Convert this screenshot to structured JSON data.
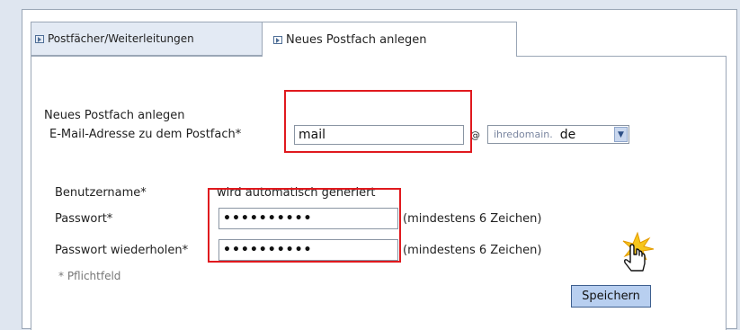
{
  "tabs": [
    {
      "label": "Postfächer/Weiterleitungen"
    },
    {
      "label": "Neues Postfach anlegen"
    }
  ],
  "form": {
    "heading": "Neues Postfach anlegen",
    "email_label": "E-Mail-Adresse zu dem Postfach*",
    "email_value": "mail",
    "at_sign": "@",
    "domain_placeholder": "ihredomain.",
    "domain_tld": "de",
    "username_label": "Benutzername*",
    "username_value": "wird automatisch generiert",
    "password_label": "Passwort*",
    "password_value": "••••••••••",
    "password_hint": "(mindestens 6 Zeichen)",
    "password_repeat_label": "Passwort wiederholen*",
    "password_repeat_value": "••••••••••",
    "password_repeat_hint": "(mindestens 6 Zeichen)",
    "required_note": "* Pflichtfeld",
    "save_label": "Speichern"
  },
  "colors": {
    "highlight": "#e0191e",
    "button": "#b8cff0",
    "page_background": "#dfe6f0"
  }
}
